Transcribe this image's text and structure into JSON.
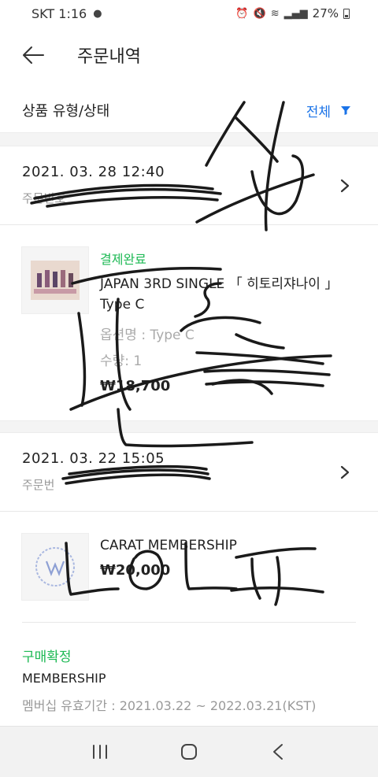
{
  "status_bar": {
    "carrier_time": "SKT 1:16",
    "battery": "27%"
  },
  "header": {
    "back_icon": "back-arrow-icon",
    "title": "주문내역"
  },
  "filter": {
    "label": "상품 유형/상태",
    "value": "전체",
    "icon": "filter-icon",
    "accent": "#1a73e8"
  },
  "orders": [
    {
      "date": "2021. 03. 28 12:40",
      "order_no_prefix": "주문번호"
    },
    {
      "date": "2021. 03. 22 15:05",
      "order_no_prefix": "주문번"
    }
  ],
  "products": [
    {
      "status": "결제완료",
      "name_line1": "JAPAN 3RD SINGLE 「 히토리쟈나이 」",
      "name_line2": "Type C",
      "option": "옵션명 : Type C",
      "qty": "수량: 1",
      "price": "₩18,700"
    },
    {
      "name": "CARAT MEMBERSHIP",
      "price": "₩20,000"
    }
  ],
  "confirmation": {
    "status": "구매확정",
    "title": "MEMBERSHIP",
    "period": "멤버십 유효기간 : 2021.03.22 ~ 2022.03.21(KST)"
  },
  "colors": {
    "status_green": "#1db954",
    "scribble_ink": "#1a1a1a"
  },
  "nav": {
    "recent_icon": "recent-apps-icon",
    "home_icon": "home-icon",
    "back_icon": "nav-back-icon"
  }
}
